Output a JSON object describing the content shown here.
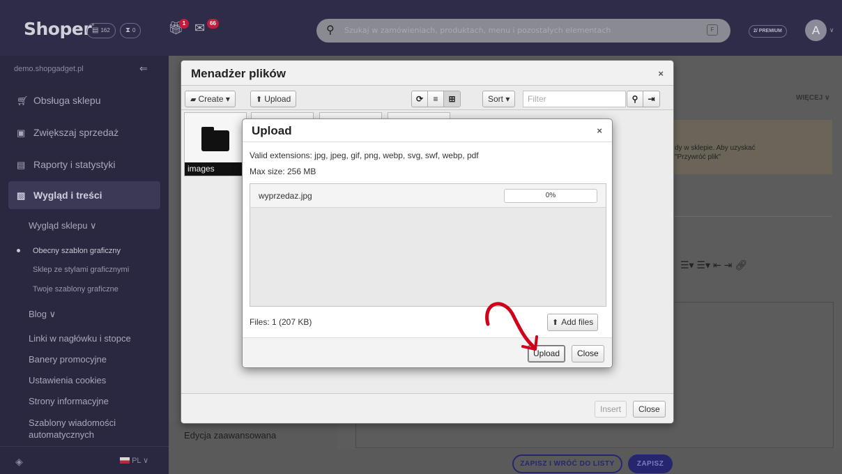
{
  "topbar": {
    "logo": "Shoper",
    "logo_mark": "°",
    "orders_count": "162",
    "pending_count": "0",
    "gift_badge": "1",
    "mail_badge": "66",
    "search_placeholder": "Szukaj w zamówieniach, produktach, menu i pozostałych elementach",
    "search_shortcut": "F",
    "premium": "PREMIUM",
    "premium_icon": "2/",
    "avatar": "A"
  },
  "sidebar": {
    "site": "demo.shopgadget.pl",
    "items": [
      {
        "label": "Obsługa sklepu",
        "icon": "cart-icon"
      },
      {
        "label": "Zwiększaj sprzedaż",
        "icon": "chart-icon"
      },
      {
        "label": "Raporty i statystyki",
        "icon": "report-icon"
      },
      {
        "label": "Wygląd i treści",
        "icon": "image-icon"
      }
    ],
    "sub_head": "Wygląd sklepu",
    "sub_items": [
      "Obecny szablon graficzny",
      "Sklep ze stylami graficznymi",
      "Twoje szablony graficzne"
    ],
    "blog": "Blog",
    "links": [
      "Linki w nagłówku i stopce",
      "Banery promocyjne",
      "Ustawienia cookies",
      "Strony informacyjne"
    ],
    "last_link_1": "Szablony wiadomości",
    "last_link_2": "automatycznych",
    "lang": "PL"
  },
  "page": {
    "more": "WIĘCEJ",
    "notice_1": "dy w sklepie. Aby uzyskać",
    "notice_2": "\"Przywróć plik\"",
    "advanced_edit": "Edycja zaawansowana",
    "save_and_back": "ZAPISZ I WRÓĆ DO LISTY",
    "save": "ZAPISZ"
  },
  "file_manager": {
    "title": "Menadżer plików",
    "close_x": "×",
    "create": "Create",
    "upload": "Upload",
    "sort": "Sort",
    "filter_placeholder": "Filter",
    "folder_name": "images",
    "insert": "Insert",
    "close": "Close"
  },
  "upload_dialog": {
    "title": "Upload",
    "close_x": "×",
    "extensions": "Valid extensions: jpg, jpeg, gif, png, webp, svg, swf, webp, pdf",
    "max_size": "Max size: 256 MB",
    "file_name": "wyprzedaz.jpg",
    "progress_text": "0%",
    "progress_value": 0,
    "files_summary": "Files: 1 (207 KB)",
    "add_files": "Add files",
    "upload": "Upload",
    "close": "Close"
  },
  "colors": {
    "topbar": "#2e2c48",
    "sidebar": "#2a2840",
    "accent": "#25266e",
    "arrow": "#d0021b"
  }
}
